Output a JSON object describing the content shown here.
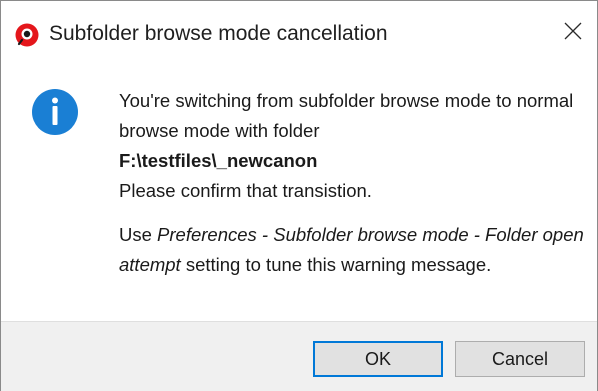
{
  "window": {
    "title": "Subfolder browse mode cancellation",
    "app_icon": "app-logo-icon",
    "close_icon": "close-icon"
  },
  "message": {
    "icon": "info-icon",
    "intro": "You're switching from subfolder browse mode to normal browse mode with folder",
    "folder_path": "F:\\testfiles\\_newcanon",
    "confirm": "Please confirm that transistion.",
    "hint_prefix": "Use ",
    "hint_setting": "Preferences - Subfolder browse mode - Folder open attempt",
    "hint_suffix": " setting to tune this warning message."
  },
  "buttons": {
    "ok_label": "OK",
    "cancel_label": "Cancel"
  },
  "colors": {
    "info_blue": "#1a7fd4",
    "app_icon_red": "#e4161b",
    "accent": "#0078d7"
  }
}
